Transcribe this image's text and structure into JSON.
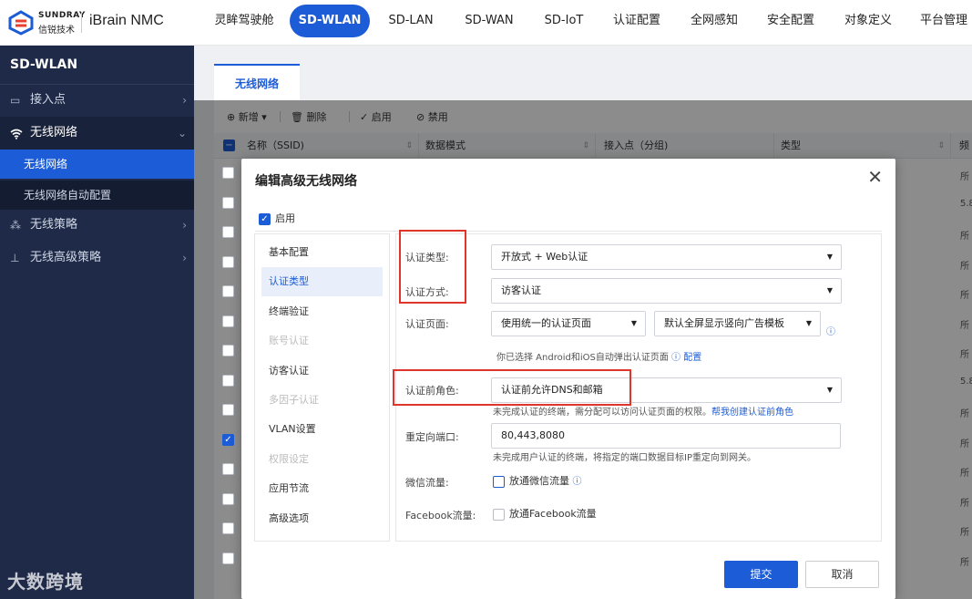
{
  "brand": {
    "en": "SUNDRAY",
    "cn": "信锐技术",
    "product": "iBrain NMC"
  },
  "nav": [
    "灵眸驾驶舱",
    "SD-WLAN",
    "SD-LAN",
    "SD-WAN",
    "SD-IoT",
    "认证配置",
    "全网感知",
    "安全配置",
    "对象定义",
    "平台管理"
  ],
  "sidebar": {
    "title": "SD-WLAN",
    "items": [
      {
        "label": "接入点"
      },
      {
        "label": "无线网络"
      },
      {
        "label": "无线策略"
      },
      {
        "label": "无线高级策略"
      }
    ],
    "subitems": [
      {
        "label": "无线网络"
      },
      {
        "label": "无线网络自动配置"
      }
    ]
  },
  "watermark": "大数跨境",
  "page": {
    "tab": "无线网络",
    "toolbar": {
      "add": "新增",
      "delete": "删除",
      "enable": "启用",
      "disable": "禁用"
    },
    "columns": [
      "名称（SSID)",
      "数据模式",
      "接入点（分组)",
      "类型",
      "频"
    ],
    "row_values": [
      "所",
      "5.8",
      "所",
      "所",
      "所",
      "所",
      "所",
      "5.8",
      "所",
      "所",
      "所",
      "所",
      "所",
      "所"
    ]
  },
  "modal": {
    "title": "编辑高级无线网络",
    "enable_label": "启用",
    "nav": [
      {
        "label": "基本配置",
        "state": "normal"
      },
      {
        "label": "认证类型",
        "state": "active"
      },
      {
        "label": "终端验证",
        "state": "normal"
      },
      {
        "label": "账号认证",
        "state": "disabled"
      },
      {
        "label": "访客认证",
        "state": "normal"
      },
      {
        "label": "多因子认证",
        "state": "disabled"
      },
      {
        "label": "VLAN设置",
        "state": "normal"
      },
      {
        "label": "权限设定",
        "state": "disabled"
      },
      {
        "label": "应用节流",
        "state": "normal"
      },
      {
        "label": "高级选项",
        "state": "normal"
      }
    ],
    "form": {
      "auth_type_label": "认证类型:",
      "auth_type_value": "开放式 + Web认证",
      "auth_method_label": "认证方式:",
      "auth_method_value": "访客认证",
      "auth_page_label": "认证页面:",
      "auth_page_value": "使用统一的认证页面",
      "ad_template_value": "默认全屏显示竖向广告模板",
      "auth_page_hint": "你已选择 Android和iOS自动弹出认证页面",
      "auth_page_hint_link": "配置",
      "pre_role_label": "认证前角色:",
      "pre_role_value": "认证前允许DNS和邮箱",
      "pre_role_hint": "未完成认证的终端，需分配可以访问认证页面的权限。",
      "pre_role_link": "帮我创建认证前角色",
      "redirect_label": "重定向端口:",
      "redirect_value": "80,443,8080",
      "redirect_hint": "未完成用户认证的终端，将指定的端口数据目标IP重定向到网关。",
      "wechat_label": "微信流量:",
      "wechat_check": "放通微信流量",
      "facebook_label": "Facebook流量:",
      "facebook_check": "放通Facebook流量"
    },
    "submit": "提交",
    "cancel": "取消"
  }
}
